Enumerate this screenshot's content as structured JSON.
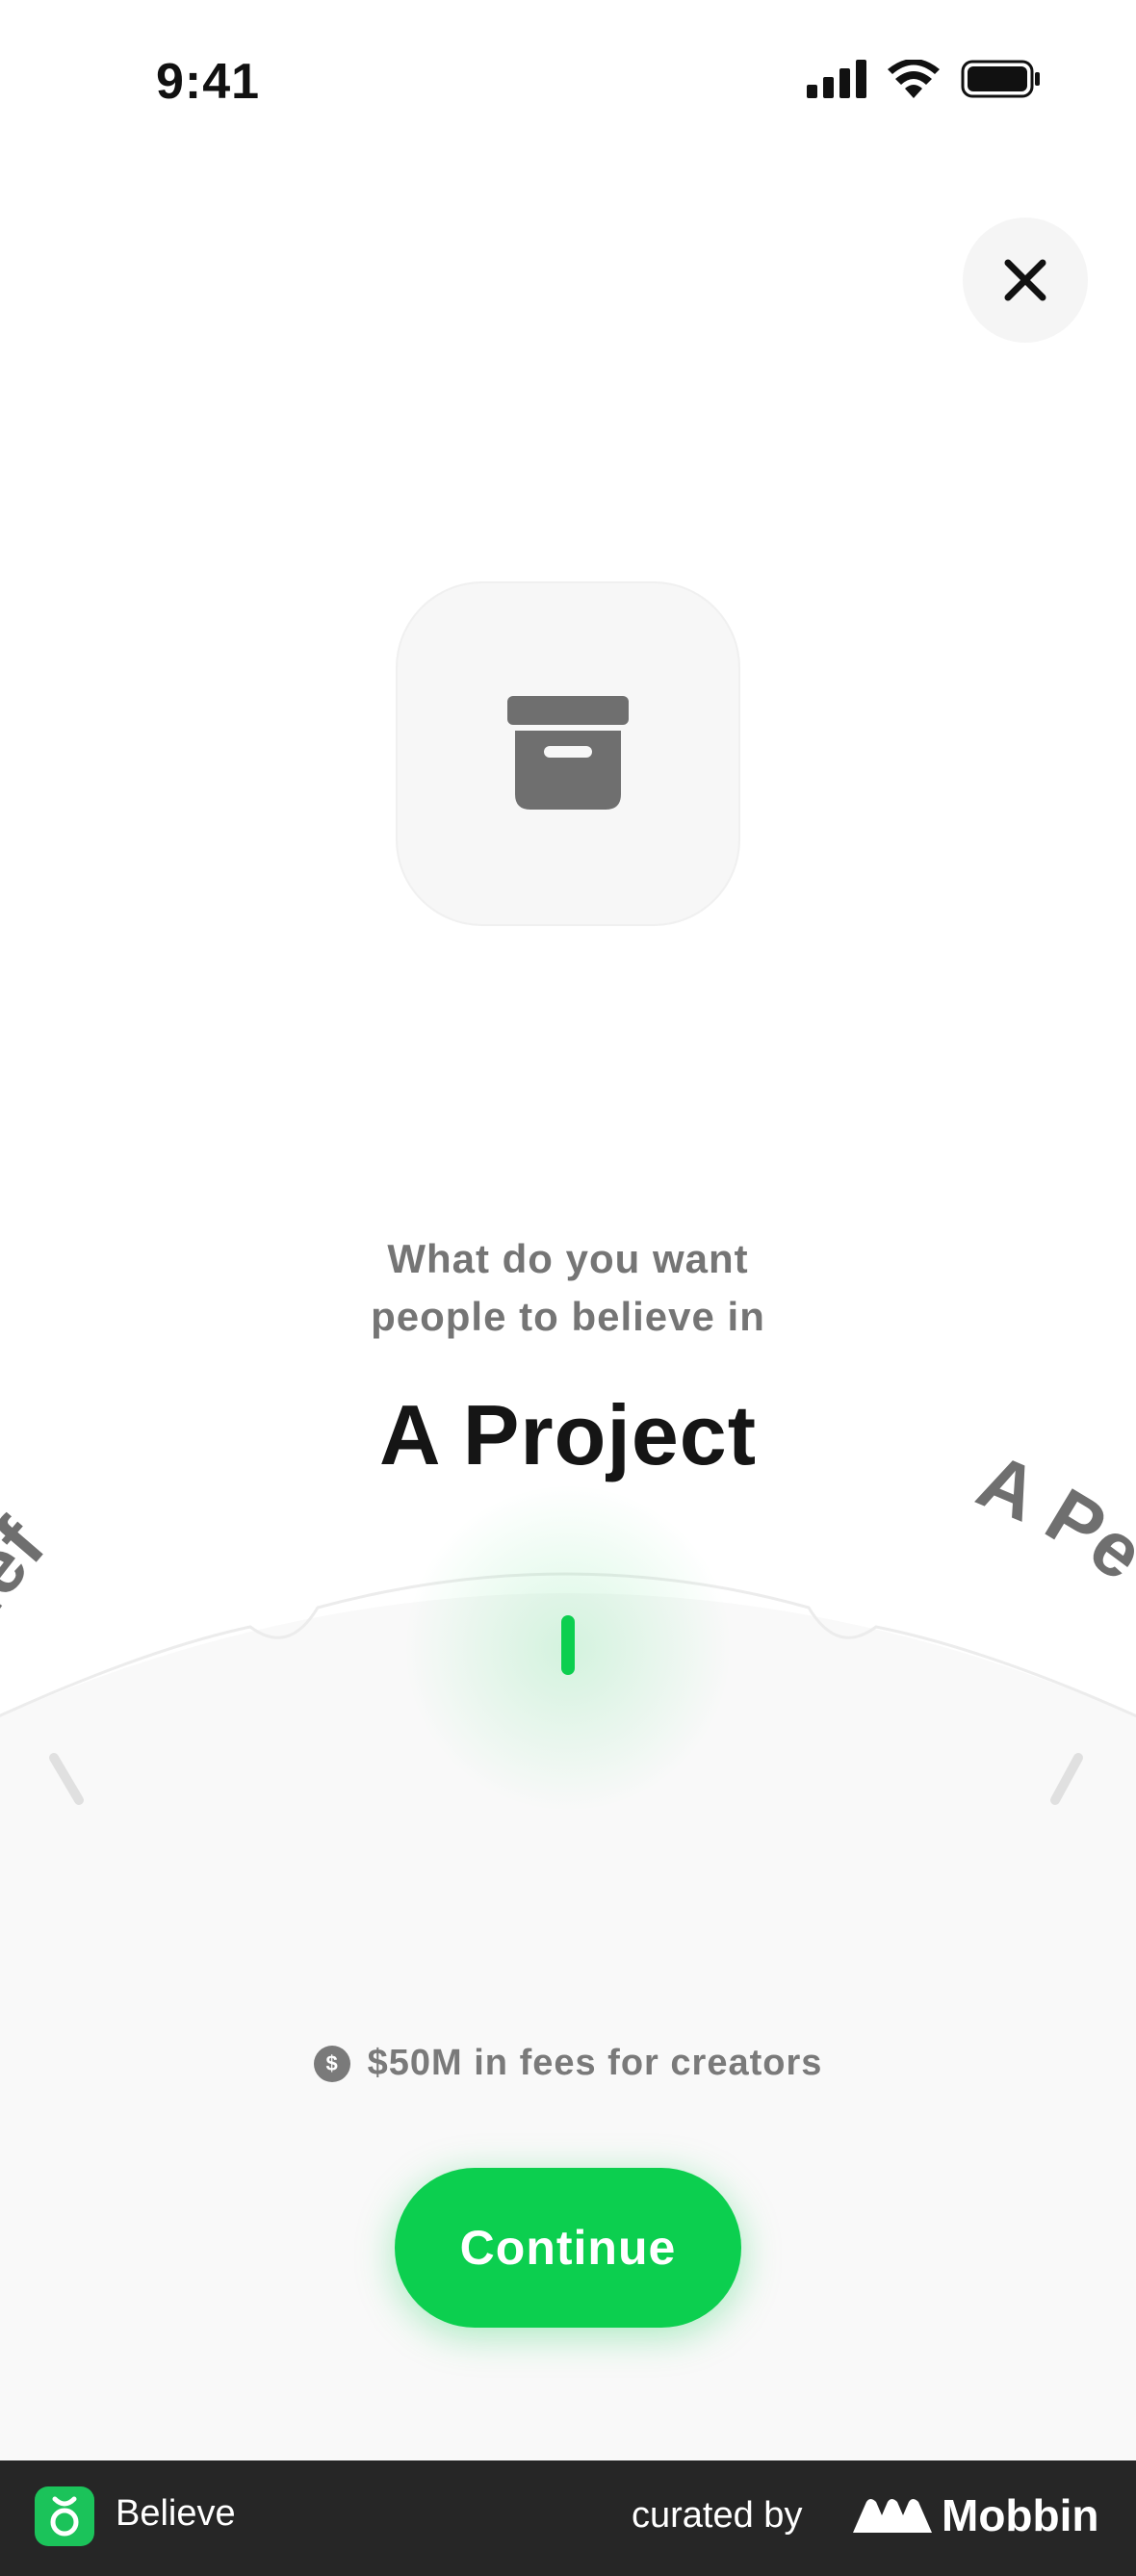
{
  "status_bar": {
    "time": "9:41"
  },
  "close_button": {
    "icon": "close-icon"
  },
  "hero": {
    "icon": "archive-box-icon"
  },
  "prompt": {
    "line1": "What do you want",
    "line2": "people to believe in"
  },
  "wheel": {
    "selected": "A Project",
    "left_option_partial": "lief",
    "right_option_partial": "A Pe"
  },
  "fees": {
    "icon_symbol": "$",
    "text": "$50M in fees for creators"
  },
  "continue_label": "Continue",
  "footer": {
    "app_name": "Believe",
    "curated_by": "curated by",
    "brand": "Mobbin"
  },
  "colors": {
    "accent": "#0CCF4F",
    "text_dark": "#151515",
    "text_muted": "#757575",
    "footer_bg": "#262626"
  }
}
